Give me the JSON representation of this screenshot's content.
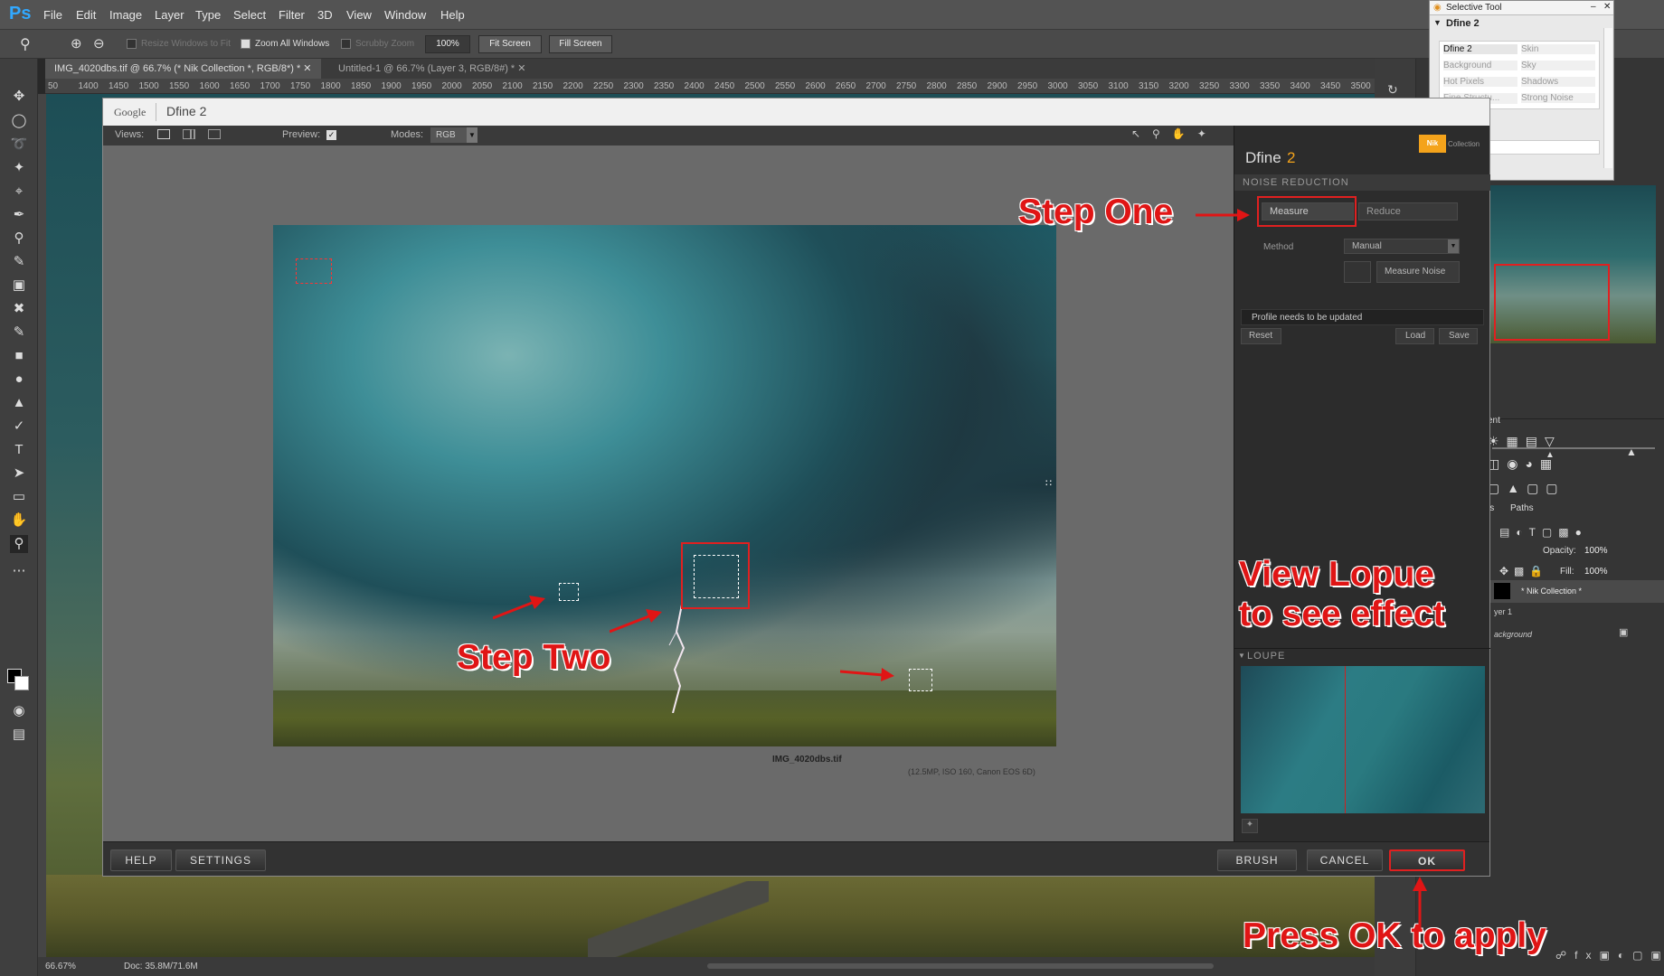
{
  "app": {
    "logo": "Ps",
    "menu": [
      "File",
      "Edit",
      "Image",
      "Layer",
      "Type",
      "Select",
      "Filter",
      "3D",
      "View",
      "Window",
      "Help"
    ]
  },
  "options": {
    "resize_windows": "Resize Windows to Fit",
    "zoom_all": "Zoom All Windows",
    "scrubby": "Scrubby Zoom",
    "zoom_value": "100%",
    "fit_screen": "Fit Screen",
    "fill_screen": "Fill Screen"
  },
  "tabs": [
    "IMG_4020dbs.tif @ 66.7% (* Nik Collection *, RGB/8*) *",
    "Untitled-1 @ 66.7% (Layer 3, RGB/8#) *"
  ],
  "ruler": [
    "50",
    "1400",
    "1450",
    "1500",
    "1550",
    "1600",
    "1650",
    "1700",
    "1750",
    "1800",
    "1850",
    "1900",
    "1950",
    "2000",
    "2050",
    "2100",
    "2150",
    "2200",
    "2250",
    "2300",
    "2350",
    "2400",
    "2450",
    "2500",
    "2550",
    "2600",
    "2650",
    "2700",
    "2750",
    "2800",
    "2850",
    "2900",
    "2950",
    "3000",
    "3050",
    "3100",
    "3150",
    "3200",
    "3250",
    "3300",
    "3350",
    "3400",
    "3450",
    "3500"
  ],
  "status": {
    "zoom": "66.67%",
    "doc": "Doc: 35.8M/71.6M"
  },
  "selective_tool": {
    "title": "Selective Tool",
    "header": "Dfine 2",
    "items": [
      [
        "Dfine 2",
        "Skin"
      ],
      [
        "Background",
        "Sky"
      ],
      [
        "Hot Pixels",
        "Shadows"
      ],
      [
        "Fine Structu...",
        "Strong Noise"
      ]
    ]
  },
  "layers": {
    "adjustments": "ent",
    "tabs": [
      "ls",
      "Paths"
    ],
    "opacity_label": "Opacity:",
    "opacity": "100%",
    "fill_label": "Fill:",
    "fill": "100%",
    "items": [
      "* Nik Collection *",
      "yer 1",
      "ackground"
    ]
  },
  "dialog": {
    "brand": "Google",
    "title": "Dfine 2",
    "views_label": "Views:",
    "preview_label": "Preview:",
    "modes_label": "Modes:",
    "mode_value": "RGB",
    "file_name": "IMG_4020dbs.tif",
    "file_info": "(12.5MP, ISO 160, Canon EOS 6D)",
    "panel": {
      "logo": "Collection",
      "title_a": "Dfine",
      "title_b": "2",
      "section": "NOISE REDUCTION",
      "measure": "Measure",
      "reduce": "Reduce",
      "method_label": "Method",
      "method_value": "Manual",
      "measure_noise": "Measure Noise",
      "profile_msg": "Profile needs to be updated",
      "reset": "Reset",
      "load": "Load",
      "save": "Save",
      "loupe": "LOUPE"
    },
    "footer": {
      "help": "HELP",
      "settings": "SETTINGS",
      "brush": "BRUSH",
      "cancel": "CANCEL",
      "ok": "OK"
    }
  },
  "annotations": {
    "step_one": "Step One",
    "step_two": "Step Two",
    "view_loupe_1": "View Lopue",
    "view_loupe_2": "to see effect",
    "press_ok": "Press OK to apply"
  },
  "colors": {
    "annotation": "#e01515",
    "ps_blue": "#31a8ff",
    "nik_orange": "#f4a31b"
  }
}
